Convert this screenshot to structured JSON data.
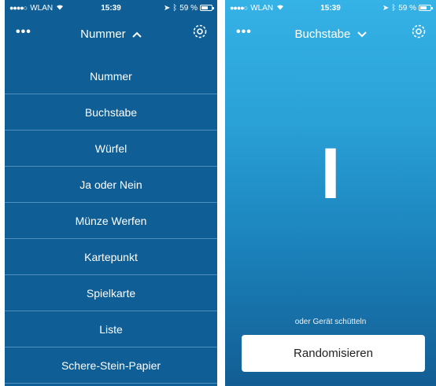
{
  "left_screen": {
    "status": {
      "carrier": "WLAN",
      "time": "15:39",
      "battery": "59 %"
    },
    "nav": {
      "more": "•••",
      "title": "Nummer",
      "caret": "^"
    },
    "menu": [
      "Nummer",
      "Buchstabe",
      "Würfel",
      "Ja oder Nein",
      "Münze Werfen",
      "Kartepunkt",
      "Spielkarte",
      "Liste",
      "Schere-Stein-Papier"
    ]
  },
  "right_screen": {
    "status": {
      "carrier": "WLAN",
      "time": "15:39",
      "battery": "59 %"
    },
    "nav": {
      "more": "•••",
      "title": "Buchstabe",
      "caret": "⌄"
    },
    "result": "I",
    "hint": "oder Gerät schütteln",
    "button_label": "Randomisieren"
  },
  "colors": {
    "menu_bg": "#0f5f96",
    "gradient_top": "#35b2e6",
    "gradient_bottom": "#125d93"
  }
}
